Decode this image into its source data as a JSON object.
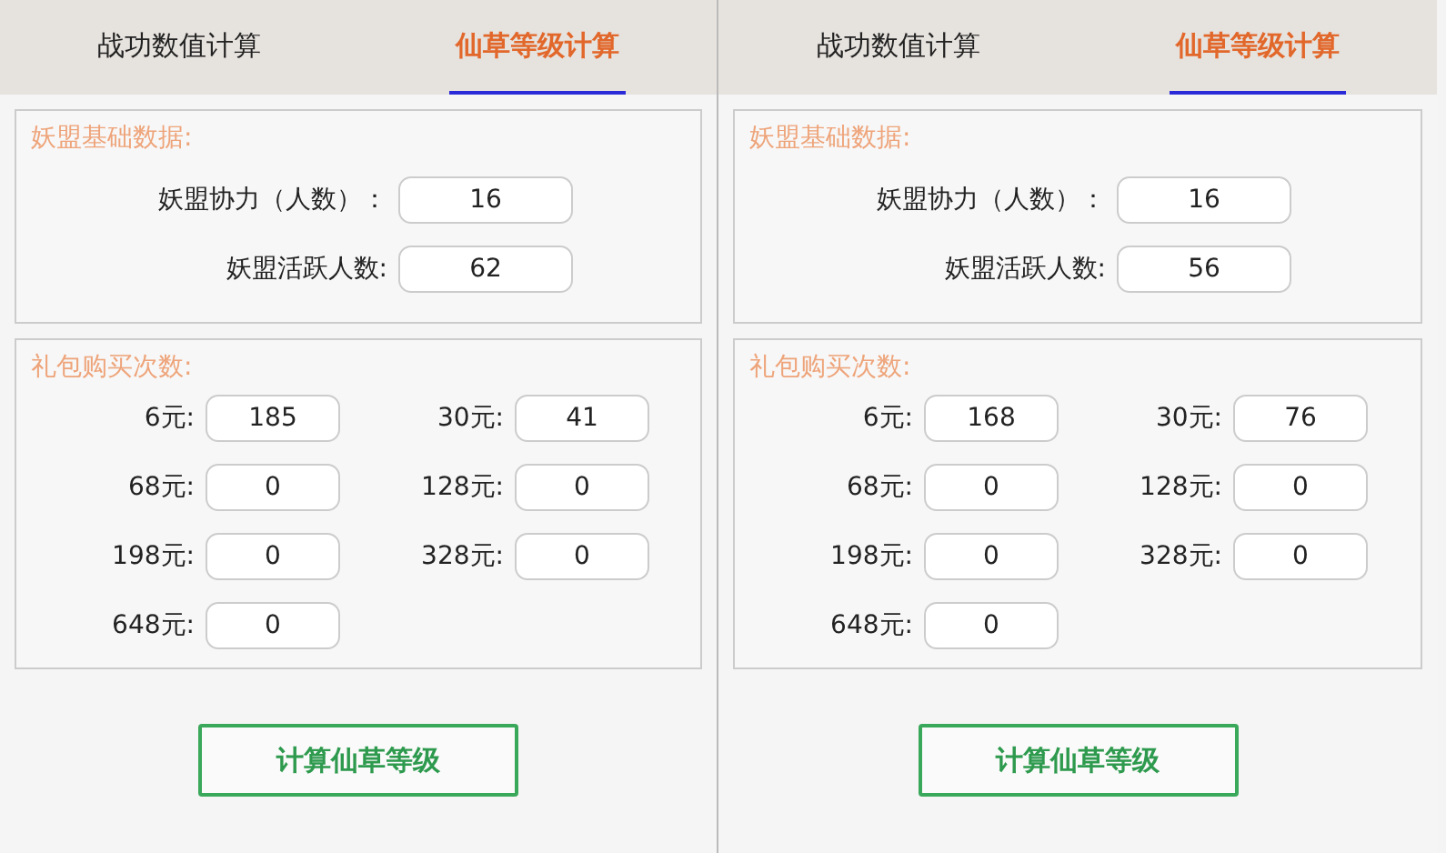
{
  "panels": [
    {
      "tabs": [
        {
          "label": "战功数值计算",
          "selected": false
        },
        {
          "label": "仙草等级计算",
          "selected": true
        }
      ],
      "base_group": {
        "title": "妖盟基础数据:",
        "fields": [
          {
            "label": "妖盟协力（人数）：",
            "value": "16"
          },
          {
            "label": "妖盟活跃人数:",
            "value": "62"
          }
        ]
      },
      "purchase_group": {
        "title": "礼包购买次数:",
        "items": [
          {
            "label": "6元:",
            "value": "185"
          },
          {
            "label": "30元:",
            "value": "41"
          },
          {
            "label": "68元:",
            "value": "0"
          },
          {
            "label": "128元:",
            "value": "0"
          },
          {
            "label": "198元:",
            "value": "0"
          },
          {
            "label": "328元:",
            "value": "0"
          },
          {
            "label": "648元:",
            "value": "0"
          }
        ]
      },
      "button": "计算仙草等级"
    },
    {
      "tabs": [
        {
          "label": "战功数值计算",
          "selected": false
        },
        {
          "label": "仙草等级计算",
          "selected": true
        }
      ],
      "base_group": {
        "title": "妖盟基础数据:",
        "fields": [
          {
            "label": "妖盟协力（人数）：",
            "value": "16"
          },
          {
            "label": "妖盟活跃人数:",
            "value": "56"
          }
        ]
      },
      "purchase_group": {
        "title": "礼包购买次数:",
        "items": [
          {
            "label": "6元:",
            "value": "168"
          },
          {
            "label": "30元:",
            "value": "76"
          },
          {
            "label": "68元:",
            "value": "0"
          },
          {
            "label": "128元:",
            "value": "0"
          },
          {
            "label": "198元:",
            "value": "0"
          },
          {
            "label": "328元:",
            "value": "0"
          },
          {
            "label": "648元:",
            "value": "0"
          }
        ]
      },
      "button": "计算仙草等级"
    }
  ]
}
